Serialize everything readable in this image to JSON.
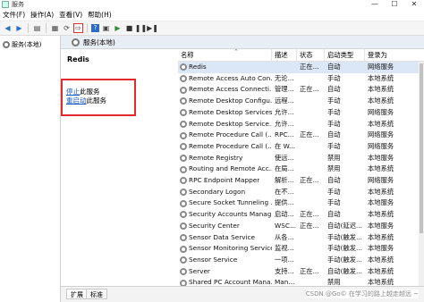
{
  "window": {
    "title": "服务",
    "buttons": [
      "—",
      "☐",
      "✕"
    ]
  },
  "menubar": [
    {
      "label": "文件(F)",
      "name": "menu-file"
    },
    {
      "label": "操作(A)",
      "name": "menu-action"
    },
    {
      "label": "查看(V)",
      "name": "menu-view"
    },
    {
      "label": "帮助(H)",
      "name": "menu-help"
    }
  ],
  "toolbar": {
    "icons": [
      "back-icon",
      "forward-icon",
      "console-tree-icon",
      "properties-icon",
      "refresh-icon",
      "export-list-icon",
      "help-icon",
      "properties-pane-icon",
      "start-service-icon",
      "stop-service-icon",
      "pause-service-icon",
      "restart-service-icon"
    ],
    "highlight_color": "#e33333"
  },
  "tree": {
    "root_label": "服务(本地)"
  },
  "main": {
    "header_title": "服务(本地)"
  },
  "description": {
    "service_name": "Redis",
    "stop_link": "停止",
    "stop_suffix": "此服务",
    "restart_link": "重启动",
    "restart_suffix": "此服务",
    "box_color": "#e32a2a"
  },
  "table": {
    "columns": [
      "名称",
      "描述",
      "状态",
      "启动类型",
      "登录为"
    ],
    "rows": [
      {
        "name": "Redis",
        "desc": "",
        "status": "正在...",
        "startup": "自动",
        "logon": "网络服务",
        "selected": true
      },
      {
        "name": "Remote Access Auto Con...",
        "desc": "无论...",
        "status": "",
        "startup": "手动",
        "logon": "本地系统"
      },
      {
        "name": "Remote Access Connecti...",
        "desc": "管理...",
        "status": "正在...",
        "startup": "自动",
        "logon": "本地系统"
      },
      {
        "name": "Remote Desktop Configu...",
        "desc": "远程...",
        "status": "",
        "startup": "手动",
        "logon": "本地系统"
      },
      {
        "name": "Remote Desktop Services",
        "desc": "允许...",
        "status": "",
        "startup": "手动",
        "logon": "网络服务"
      },
      {
        "name": "Remote Desktop Service...",
        "desc": "允许...",
        "status": "",
        "startup": "手动",
        "logon": "本地系统"
      },
      {
        "name": "Remote Procedure Call (...",
        "desc": "RPC...",
        "status": "正在...",
        "startup": "自动",
        "logon": "网络服务"
      },
      {
        "name": "Remote Procedure Call (...",
        "desc": "在 W...",
        "status": "",
        "startup": "手动",
        "logon": "网络服务"
      },
      {
        "name": "Remote Registry",
        "desc": "使远...",
        "status": "",
        "startup": "禁用",
        "logon": "本地服务"
      },
      {
        "name": "Routing and Remote Acc...",
        "desc": "在局...",
        "status": "",
        "startup": "禁用",
        "logon": "本地系统"
      },
      {
        "name": "RPC Endpoint Mapper",
        "desc": "解析...",
        "status": "正在...",
        "startup": "自动",
        "logon": "网络服务"
      },
      {
        "name": "Secondary Logon",
        "desc": "在不...",
        "status": "",
        "startup": "手动",
        "logon": "本地系统"
      },
      {
        "name": "Secure Socket Tunneling ...",
        "desc": "提供...",
        "status": "",
        "startup": "手动",
        "logon": "本地服务"
      },
      {
        "name": "Security Accounts Manag...",
        "desc": "启动...",
        "status": "正在...",
        "startup": "自动",
        "logon": "本地系统"
      },
      {
        "name": "Security Center",
        "desc": "WSC...",
        "status": "正在...",
        "startup": "自动(延迟...",
        "logon": "本地服务"
      },
      {
        "name": "Sensor Data Service",
        "desc": "从各...",
        "status": "",
        "startup": "手动(触发...",
        "logon": "本地系统"
      },
      {
        "name": "Sensor Monitoring Service",
        "desc": "监视...",
        "status": "",
        "startup": "手动(触发...",
        "logon": "本地服务"
      },
      {
        "name": "Sensor Service",
        "desc": "一项...",
        "status": "",
        "startup": "手动(触发...",
        "logon": "本地系统"
      },
      {
        "name": "Server",
        "desc": "支持...",
        "status": "正在...",
        "startup": "自动(触发...",
        "logon": "本地系统"
      },
      {
        "name": "Shared PC Account Mana...",
        "desc": "Man...",
        "status": "",
        "startup": "禁用",
        "logon": "本地系统"
      }
    ]
  },
  "tabs": [
    "扩展",
    "标准"
  ],
  "watermark": "CSDN @Go© 在学习的路上越走越远 ~"
}
